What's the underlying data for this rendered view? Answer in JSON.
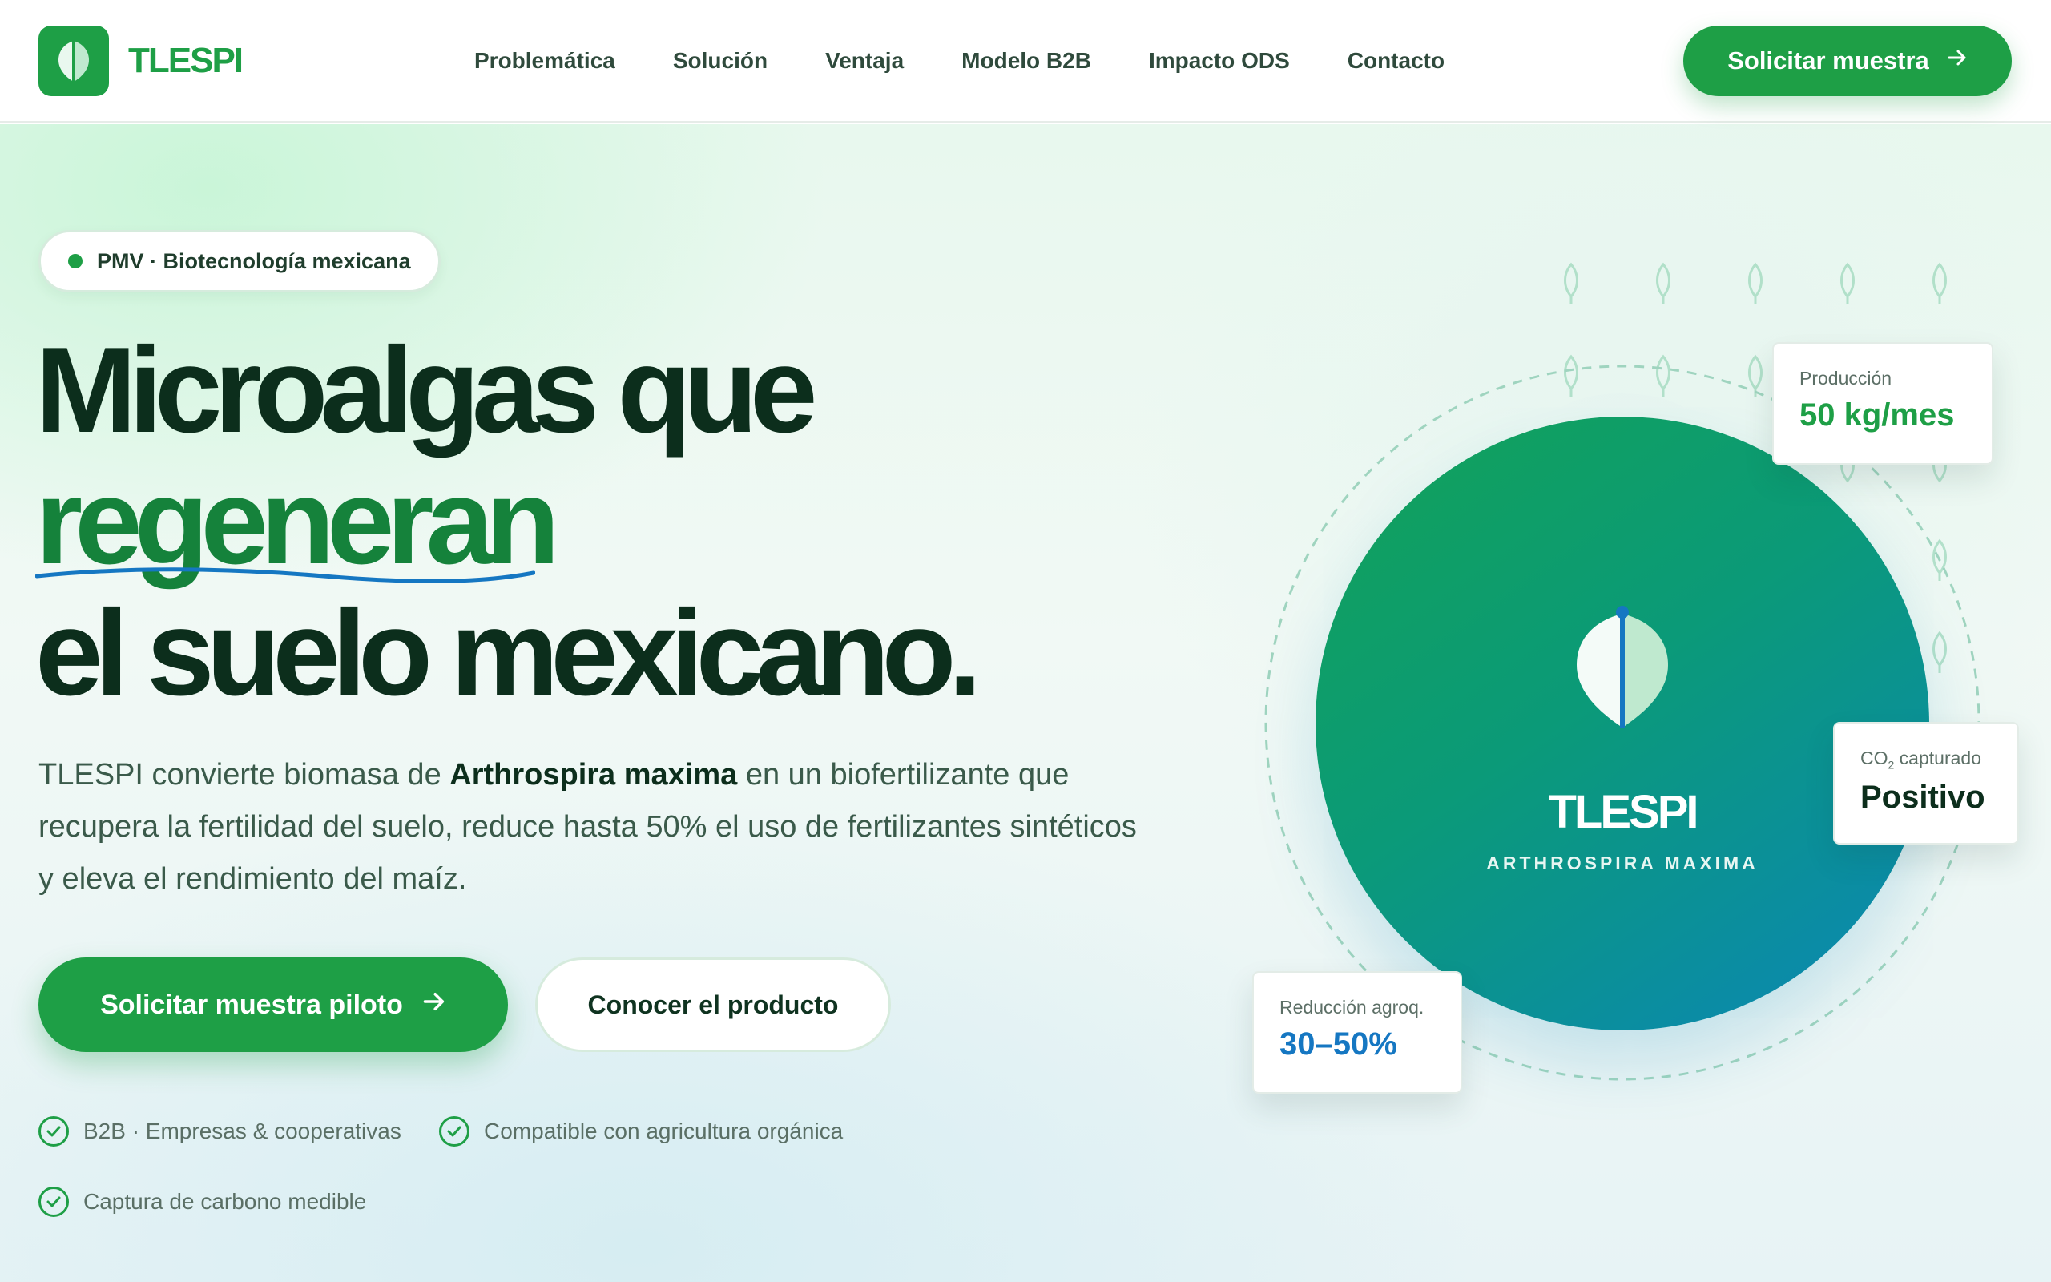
{
  "brand": {
    "name": "TLESPI",
    "color": "#1e9f46"
  },
  "nav": {
    "items": [
      "Problemática",
      "Solución",
      "Ventaja",
      "Modelo B2B",
      "Impacto ODS",
      "Contacto"
    ],
    "cta_label": "Solicitar muestra",
    "cta_icon": "arrow-right-icon"
  },
  "hero": {
    "badge": "PMV · Biotecnología mexicana",
    "headline": {
      "line1": "Microalgas que",
      "accent": "regeneran",
      "line3": "el suelo mexicano."
    },
    "lead": {
      "part1": "TLESPI convierte biomasa de ",
      "bold": "Arthrospira maxima",
      "part2": " en un biofertilizante que recupera la fertilidad del suelo, reduce hasta 50% el uso de fertilizantes sintéticos y eleva el rendimiento del maíz."
    },
    "primary_button": "Solicitar muestra piloto",
    "secondary_button": "Conocer el producto",
    "features": [
      "B2B · Empresas & cooperativas",
      "Compatible con agricultura orgánica",
      "Captura de carbono medible"
    ]
  },
  "visual": {
    "circle_title": "TLESPI",
    "circle_subtitle": "ARTHROSPIRA MAXIMA",
    "cards": {
      "production": {
        "label": "Producción",
        "value": "50 kg/mes",
        "color": "#1e9f46"
      },
      "co2": {
        "label_main": "CO",
        "label_sub": "2",
        "label_rest": " capturado",
        "value": "Positivo",
        "color": "#0c2e1c"
      },
      "reduction": {
        "label": "Reducción agroq.",
        "value": "30–50%",
        "color": "#1577c2"
      }
    }
  },
  "colors": {
    "accent_green": "#1e9f46",
    "dark_green": "#0c2e1c",
    "accent_blue": "#1577c2"
  }
}
